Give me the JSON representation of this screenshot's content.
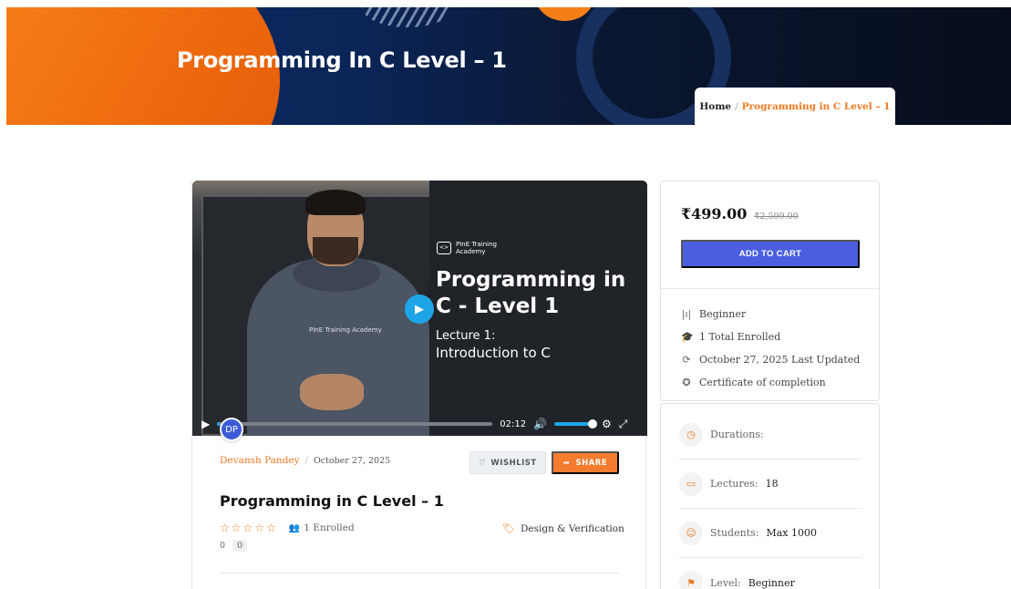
{
  "hero": {
    "title": "Programming In C Level – 1"
  },
  "breadcrumb": {
    "home": "Home",
    "separator": "/",
    "current": "Programming in C Level – 1"
  },
  "video": {
    "brand_line1": "PInE Training",
    "brand_line2": "Academy",
    "brand_logo": "<>",
    "title": "Programming in C - Level 1",
    "lecture": "Lecture 1:",
    "topic": "Introduction to C",
    "presenter_logo": "PInE Training Academy",
    "time": "02:12",
    "progress_percent": 1,
    "volume_percent": 100
  },
  "author": {
    "initials": "DP",
    "name": "Devansh Pandey",
    "separator": "/",
    "date": "October 27, 2025"
  },
  "actions": {
    "wishlist": "WISHLIST",
    "share": "SHARE"
  },
  "course": {
    "title": "Programming in C Level – 1",
    "rating": 0,
    "rating_count": "0",
    "rating_box": "0",
    "enrolled": "1 Enrolled",
    "category": "Design & Verification"
  },
  "pricing": {
    "price": "₹499.00",
    "old_price": "₹2,599.00",
    "cart_label": "ADD TO CART"
  },
  "features": [
    {
      "icon": "level-icon",
      "glyph": "|ı|",
      "text": "Beginner"
    },
    {
      "icon": "graduation-cap-icon",
      "glyph": "🎓",
      "text": "1 Total Enrolled"
    },
    {
      "icon": "refresh-icon",
      "glyph": "⟳",
      "text": "October 27, 2025 Last Updated"
    },
    {
      "icon": "certificate-icon",
      "glyph": "✪",
      "text": "Certificate of completion"
    }
  ],
  "details": [
    {
      "icon": "clock-icon",
      "glyph": "◷",
      "label": "Durations:",
      "value": ""
    },
    {
      "icon": "folder-icon",
      "glyph": "▭",
      "label": "Lectures:",
      "value": "18"
    },
    {
      "icon": "user-icon",
      "glyph": "☺",
      "label": "Students:",
      "value": "Max 1000"
    },
    {
      "icon": "flag-icon",
      "glyph": "⚑",
      "label": "Level:",
      "value": "Beginner"
    }
  ],
  "colors": {
    "accent": "#ee7a22",
    "primary_button": "#4a5fe0",
    "video_play": "#1ea5e8"
  }
}
